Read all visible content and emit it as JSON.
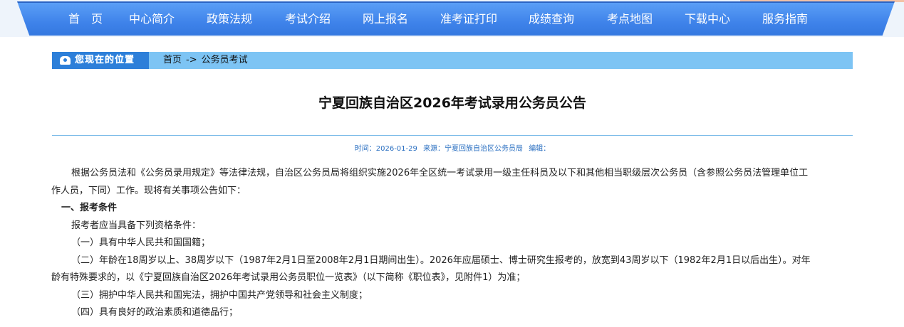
{
  "nav": {
    "items": [
      "首　页",
      "中心简介",
      "政策法规",
      "考试介绍",
      "网上报名",
      "准考证打印",
      "成绩查询",
      "考点地图",
      "下载中心",
      "服务指南"
    ]
  },
  "breadcrumb": {
    "badge": "您现在的位置",
    "home": "首页",
    "separator": "->",
    "current": "公务员考试"
  },
  "article": {
    "title": "宁夏回族自治区2026年考试录用公务员公告",
    "meta": {
      "time_label": "时间：",
      "time": "2026-01-29",
      "source_label": "来源：",
      "source": "宁夏回族自治区公务员局",
      "editor_label": "编辑："
    },
    "paragraphs": {
      "p1_line1": "根据公务员法和《公务员录用规定》等法律法规，自治区公务员局将组织实施2026年全区统一考试录用一级主任科员及以下和其他相当职级层次公务员（含参照公务员法管理单位工",
      "p1_line2": "作人员，下同）工作。现将有关事项公告如下：",
      "section1": "一、报考条件",
      "lead": "报考者应当具备下列资格条件：",
      "c1": "（一）具有中华人民共和国国籍；",
      "c2_line1": "（二）年龄在18周岁以上、38周岁以下（1987年2月1日至2008年2月1日期间出生）。2026年应届硕士、博士研究生报考的，放宽到43周岁以下（1982年2月1日以后出生）。对年",
      "c2_line2": "龄有特殊要求的，以《宁夏回族自治区2026年考试录用公务员职位一览表》（以下简称《职位表》，见附件1）为准；",
      "c3": "（三）拥护中华人民共和国宪法，拥护中国共产党领导和社会主义制度；",
      "c4": "（四）具有良好的政治素质和道德品行；"
    }
  },
  "colors": {
    "nav_bg": "#3f83ea",
    "breadcrumb_bg": "#7dc4f4",
    "badge_bg": "#2d7fd9",
    "meta_text": "#2a6fc1",
    "rule": "#7bbbe8"
  },
  "icons": {
    "breadcrumb": "location-flag-icon"
  }
}
